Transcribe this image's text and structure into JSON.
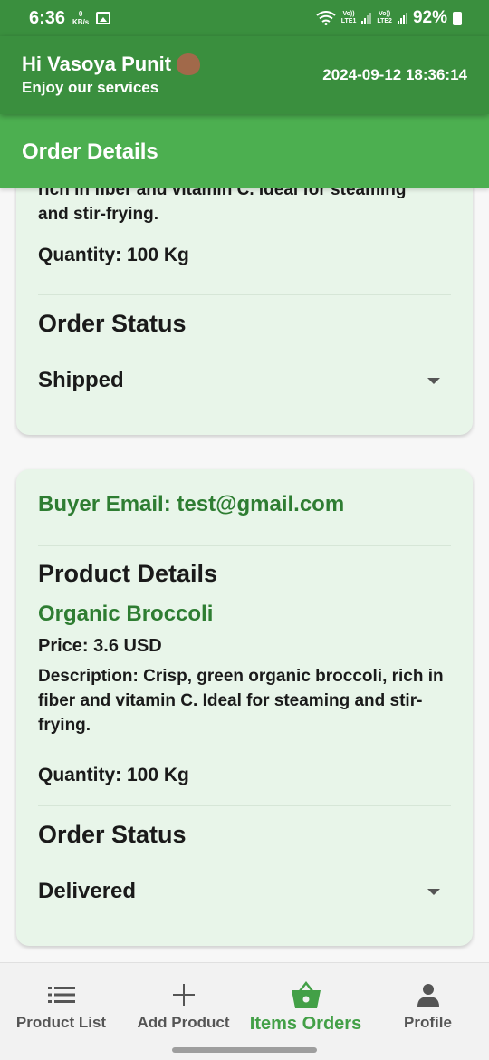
{
  "status_bar": {
    "time": "6:36",
    "net_speed_value": "0",
    "net_speed_unit": "KB/s",
    "sim1": "LTE1",
    "sim2": "LTE2",
    "battery": "92%"
  },
  "header": {
    "greeting": "Hi Vasoya Punit",
    "subtitle": "Enjoy our services",
    "datetime": "2024-09-12 18:36:14"
  },
  "page_title": "Order Details",
  "orders": [
    {
      "description_tail_line1": "rich in fiber and vitamin C. Ideal for steaming",
      "description_tail_line2": "and stir-frying.",
      "quantity": "Quantity: 100 Kg",
      "status_label": "Order Status",
      "status_value": "Shipped"
    },
    {
      "buyer_email": "Buyer Email: test@gmail.com",
      "product_details_label": "Product Details",
      "product_name": "Organic Broccoli",
      "price": "Price: 3.6 USD",
      "description": "Description: Crisp, green organic broccoli, rich in fiber and vitamin C. Ideal for steaming and stir-frying.",
      "quantity": "Quantity: 100 Kg",
      "status_label": "Order Status",
      "status_value": "Delivered"
    }
  ],
  "bottom_nav": [
    {
      "label": "Product List",
      "icon": "list-icon"
    },
    {
      "label": "Add Product",
      "icon": "plus-icon"
    },
    {
      "label": "Items Orders",
      "icon": "basket-icon",
      "active": true
    },
    {
      "label": "Profile",
      "icon": "person-icon"
    }
  ],
  "colors": {
    "header": "#3a8f3e",
    "title_bar": "#4caf50",
    "card_bg": "#e8f5e9",
    "accent_text": "#2e7d32",
    "active_nav": "#43a047"
  }
}
